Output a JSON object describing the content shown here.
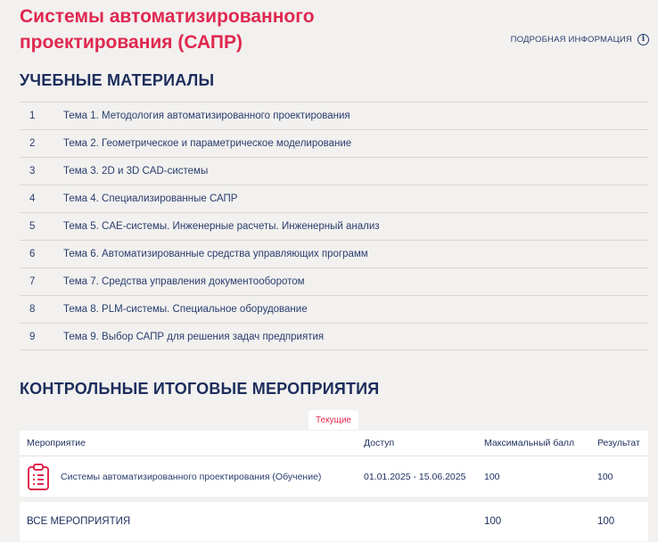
{
  "course": {
    "title": "Системы автоматизированного проектирования (САПР)",
    "more_info_label": "ПОДРОБНАЯ ИНФОРМАЦИЯ",
    "info_icon": "i"
  },
  "materials": {
    "heading": "УЧЕБНЫЕ МАТЕРИАЛЫ",
    "topics": [
      {
        "num": "1",
        "title": "Тема 1. Методология автоматизированного проектирования"
      },
      {
        "num": "2",
        "title": "Тема 2. Геометрическое и параметрическое моделирование"
      },
      {
        "num": "3",
        "title": "Тема 3. 2D и 3D CAD-системы"
      },
      {
        "num": "4",
        "title": "Тема 4. Специализированные САПР"
      },
      {
        "num": "5",
        "title": "Тема 5. CAE-системы. Инженерные расчеты. Инженерный анализ"
      },
      {
        "num": "6",
        "title": "Тема 6. Автоматизированные средства управляющих программ"
      },
      {
        "num": "7",
        "title": "Тема 7. Средства управления документооборотом"
      },
      {
        "num": "8",
        "title": "Тема 8. PLM-системы. Специальное оборудование"
      },
      {
        "num": "9",
        "title": "Тема 9. Выбор САПР для решения задач предприятия"
      }
    ]
  },
  "events": {
    "heading": "КОНТРОЛЬНЫЕ ИТОГОВЫЕ МЕРОПРИЯТИЯ",
    "tab_current": "Текущие",
    "columns": {
      "event": "Мероприятие",
      "access": "Доступ",
      "max_score": "Максимальный балл",
      "result": "Результат"
    },
    "rows": [
      {
        "name": "Системы автоматизированного проектирования (Обучение)",
        "access": "01.01.2025 - 15.06.2025",
        "max_score": "100",
        "result": "100",
        "icon": "clipboard-checklist-icon"
      }
    ],
    "total": {
      "label": "ВСЕ МЕРОПРИЯТИЯ",
      "max_score": "100",
      "result": "100"
    }
  },
  "colors": {
    "accent": "#e0284f",
    "text": "#1d2d5c",
    "background": "#f2f1ef"
  }
}
